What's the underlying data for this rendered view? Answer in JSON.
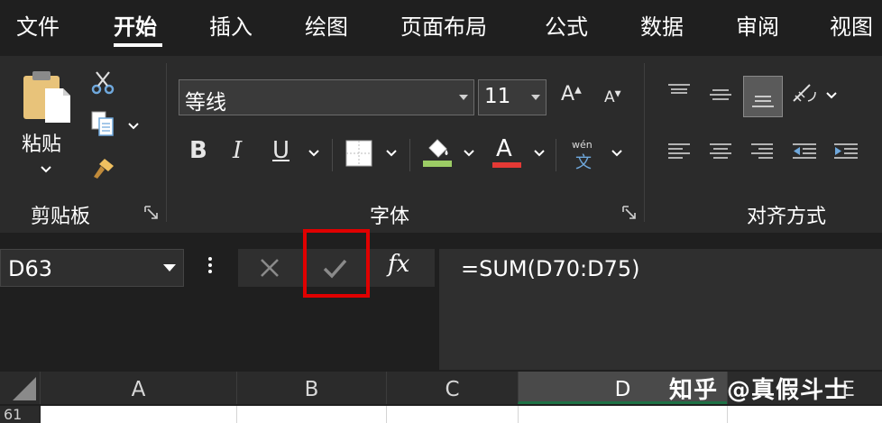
{
  "tabs": [
    {
      "label": "文件",
      "active": false
    },
    {
      "label": "开始",
      "active": true
    },
    {
      "label": "插入",
      "active": false
    },
    {
      "label": "绘图",
      "active": false
    },
    {
      "label": "页面布局",
      "active": false
    },
    {
      "label": "公式",
      "active": false
    },
    {
      "label": "数据",
      "active": false
    },
    {
      "label": "审阅",
      "active": false
    },
    {
      "label": "视图",
      "active": false
    }
  ],
  "clipboard": {
    "paste_label": "粘贴",
    "group_label": "剪贴板"
  },
  "font": {
    "font_name": "等线",
    "font_size": "11",
    "bold_label": "B",
    "italic_label": "I",
    "underline_label": "U",
    "increase_label": "A",
    "decrease_label": "A",
    "font_color_label": "A",
    "phonetic_top": "wén",
    "phonetic_bottom": "文",
    "group_label": "字体"
  },
  "alignment": {
    "group_label": "对齐方式"
  },
  "formula_bar": {
    "name_box": "D63",
    "fx_label": "fx",
    "formula": "=SUM(D70:D75)"
  },
  "grid": {
    "columns": [
      "A",
      "B",
      "C",
      "D",
      "E"
    ],
    "selected_column": "D",
    "first_row": "61"
  },
  "watermark": "知乎 @真假斗士",
  "colors": {
    "highlight": "#e00000",
    "fill_color": "#9ccc65",
    "font_color": "#e53935",
    "selected_column_accent": "#1e7145"
  }
}
